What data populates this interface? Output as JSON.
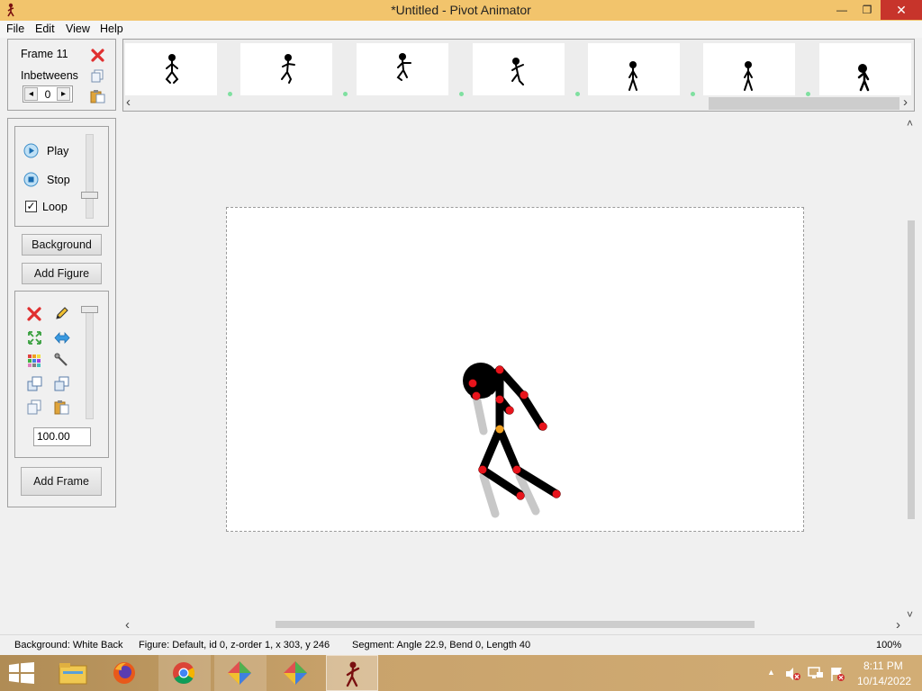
{
  "window": {
    "title": "*Untitled - Pivot Animator",
    "min_glyph": "—",
    "max_glyph": "❐",
    "close_glyph": "✕"
  },
  "menu": {
    "items": [
      "File",
      "Edit",
      "View",
      "Help"
    ]
  },
  "frame_panel": {
    "frame_label": "Frame 11",
    "inbetweens_label": "Inbetweens",
    "inbetweens_value": "0",
    "left_arrow": "◂",
    "right_arrow": "▸"
  },
  "playback": {
    "play_label": "Play",
    "stop_label": "Stop",
    "loop_label": "Loop",
    "loop_checked": true
  },
  "buttons": {
    "background": "Background",
    "add_figure": "Add Figure",
    "add_frame": "Add Frame"
  },
  "figure_tools": {
    "scale_value": "100.00"
  },
  "status": {
    "background": "Background: White Back",
    "figure": "Figure: Default,  id 0,  z-order 1,  x 303, y 246",
    "segment": "Segment: Angle 22.9,  Bend 0,  Length 40",
    "zoom": "100%"
  },
  "taskbar": {
    "time": "8:11 PM",
    "date": "10/14/2022",
    "apps": [
      "file-explorer",
      "firefox",
      "chrome",
      "app-1",
      "app-2",
      "pivot-animator"
    ]
  },
  "icons": {
    "arrow_left": "‹",
    "arrow_right": "›",
    "arrow_up": "˄",
    "arrow_down": "˅",
    "tray_up": "▲"
  },
  "colors": {
    "titlebar": "#f2c46c",
    "close": "#c7342b",
    "joint_red": "#e8141c",
    "joint_orange": "#f0a020",
    "onion_grey": "#c8c8c8",
    "frame_dot": "#7fe0a0"
  }
}
